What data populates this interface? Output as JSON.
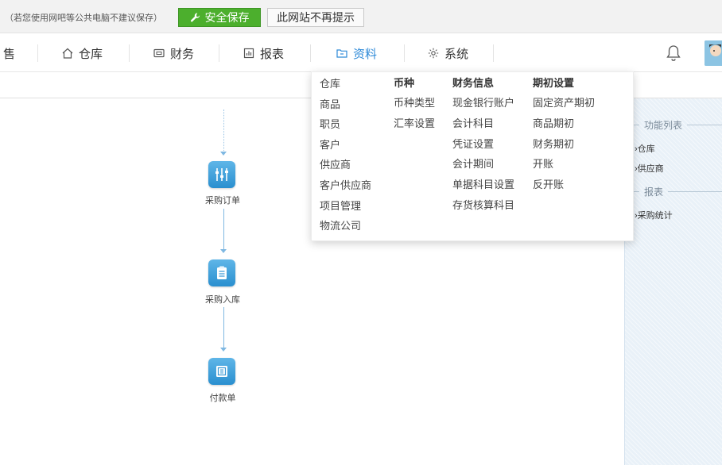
{
  "notice": {
    "text": "（若您使用网吧等公共电脑不建议保存）",
    "save_button": "安全保存",
    "no_more_button": "此网站不再提示"
  },
  "nav": {
    "items": [
      {
        "label": "售",
        "icon": "none"
      },
      {
        "label": "仓库",
        "icon": "home-icon"
      },
      {
        "label": "财务",
        "icon": "wallet-icon"
      },
      {
        "label": "报表",
        "icon": "chart-icon"
      },
      {
        "label": "资料",
        "icon": "folder-icon",
        "active": true
      },
      {
        "label": "系统",
        "icon": "gear-icon"
      }
    ],
    "accent_color": "#2e8ad8"
  },
  "workflow": {
    "steps": [
      {
        "label": "采购订单",
        "icon": "sliders-icon"
      },
      {
        "label": "采购入库",
        "icon": "clipboard-icon"
      },
      {
        "label": "付款单",
        "icon": "document-icon"
      }
    ]
  },
  "dropdown": {
    "columns": [
      {
        "heading": "",
        "items": [
          "仓库",
          "商品",
          "职员",
          "客户",
          "供应商",
          "客户供应商",
          "项目管理",
          "物流公司"
        ]
      },
      {
        "heading": "币种",
        "items": [
          "币种类型",
          "汇率设置"
        ]
      },
      {
        "heading": "财务信息",
        "items": [
          "现金银行账户",
          "会计科目",
          "凭证设置",
          "会计期间",
          "单据科目设置",
          "存货核算科目"
        ]
      },
      {
        "heading": "期初设置",
        "items": [
          "固定资产期初",
          "商品期初",
          "财务期初",
          "开账",
          "反开账"
        ]
      }
    ]
  },
  "right_panel": {
    "function_list_title": "功能列表",
    "function_links": [
      "›仓库",
      "›供应商"
    ],
    "report_title": "报表",
    "report_links": [
      "›采购统计"
    ]
  }
}
